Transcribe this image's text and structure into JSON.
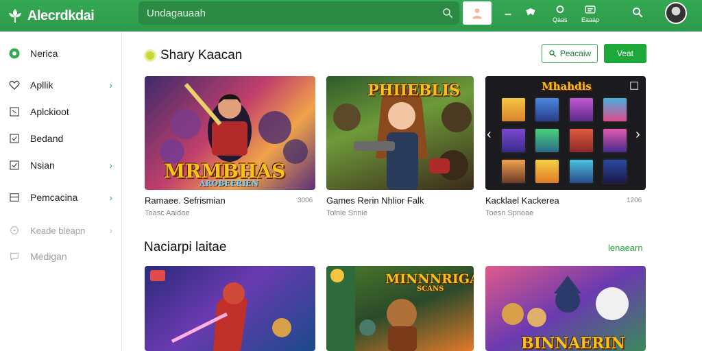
{
  "header": {
    "app_title": "Alecrdkdai",
    "search_text": "Undagauaah",
    "actions": [
      {
        "label": "",
        "icon": "chevron-down-icon"
      },
      {
        "label": "",
        "icon": "gamepad-icon"
      },
      {
        "label": "Qaas",
        "icon": "bell-icon"
      },
      {
        "label": "Eaaap",
        "icon": "inbox-icon"
      },
      {
        "label": "",
        "icon": "search-icon"
      }
    ]
  },
  "sidebar": {
    "items": [
      {
        "label": "Nerica",
        "icon": "home-icon",
        "chevron": false,
        "dim": false
      },
      {
        "label": "Apllik",
        "icon": "heart-icon",
        "chevron": true,
        "dim": false
      },
      {
        "label": "Aplckioot",
        "icon": "square-icon",
        "chevron": false,
        "dim": false
      },
      {
        "label": "Bedand",
        "icon": "check-square-icon",
        "chevron": false,
        "dim": false
      },
      {
        "label": "Nsian",
        "icon": "check-square-icon",
        "chevron": true,
        "dim": false
      },
      {
        "label": "Pemcacina",
        "icon": "card-icon",
        "chevron": true,
        "dim": false
      },
      {
        "label": "Keade bleapn",
        "icon": "settings-icon",
        "chevron": true,
        "dim": true
      },
      {
        "label": "Medigan",
        "icon": "chat-icon",
        "chevron": false,
        "dim": true
      }
    ]
  },
  "section1": {
    "title": "Shary Kaacan",
    "btn_outline": "Peacaiw",
    "btn_solid": "Veat",
    "cards": [
      {
        "art_text": "MRMBHAS",
        "art_sub": "AROBEERIEN",
        "title": "Ramaee. Sefrismian",
        "sub": "Toasc Aaidae",
        "num": "3006"
      },
      {
        "art_text": "PHIIEBLIS",
        "art_sub": "",
        "title": "Games Rerin Nhlior Falk",
        "sub": "Tolnie Snnie",
        "num": ""
      },
      {
        "art_text": "Mhahdis",
        "art_sub": "",
        "title": "Kacklael Kackerea",
        "sub": "Toesn Spnoae",
        "num": "1206"
      }
    ]
  },
  "section2": {
    "title": "Naciarpi laitae",
    "link": "lenaearn",
    "cards": [
      {
        "art_text": ""
      },
      {
        "art_text": "MINNNRIGAS",
        "art_sub": "SCANS"
      },
      {
        "art_text": "BINNAERIN"
      }
    ]
  }
}
